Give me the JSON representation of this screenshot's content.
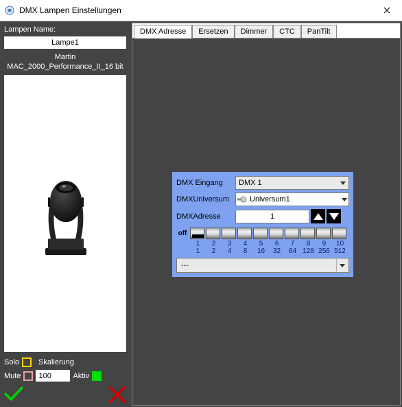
{
  "window": {
    "title": "DMX Lampen Einstellungen"
  },
  "left": {
    "lampen_name_label": "Lampen Name:",
    "lampen_name_value": "Lampe1",
    "brand": "Martin",
    "model": "MAC_2000_Performance_II_16 bit",
    "solo_label": "Solo",
    "skalierung_label": "Skalierung",
    "mute_label": "Mute",
    "scale_value": "100",
    "aktiv_label": "Aktiv"
  },
  "tabs": {
    "t0": "DMX Adresse",
    "t1": "Ersetzen",
    "t2": "Dimmer",
    "t3": "CTC",
    "t4": "PanTilt"
  },
  "dmx": {
    "eingang_label": "DMX Eingang",
    "eingang_value": "DMX 1",
    "universum_label": "DMXUniversum",
    "universum_value": "Universum1",
    "adresse_label": "DMXAdresse",
    "adresse_value": "1",
    "off_label": "off",
    "dips": {
      "n1": "1",
      "n2": "2",
      "n3": "3",
      "n4": "4",
      "n5": "5",
      "n6": "6",
      "n7": "7",
      "n8": "8",
      "n9": "9",
      "n10": "10",
      "v1": "1",
      "v2": "2",
      "v3": "4",
      "v4": "8",
      "v5": "16",
      "v6": "32",
      "v7": "64",
      "v8": "128",
      "v9": "256",
      "v10": "512"
    },
    "preset_value": "---"
  }
}
